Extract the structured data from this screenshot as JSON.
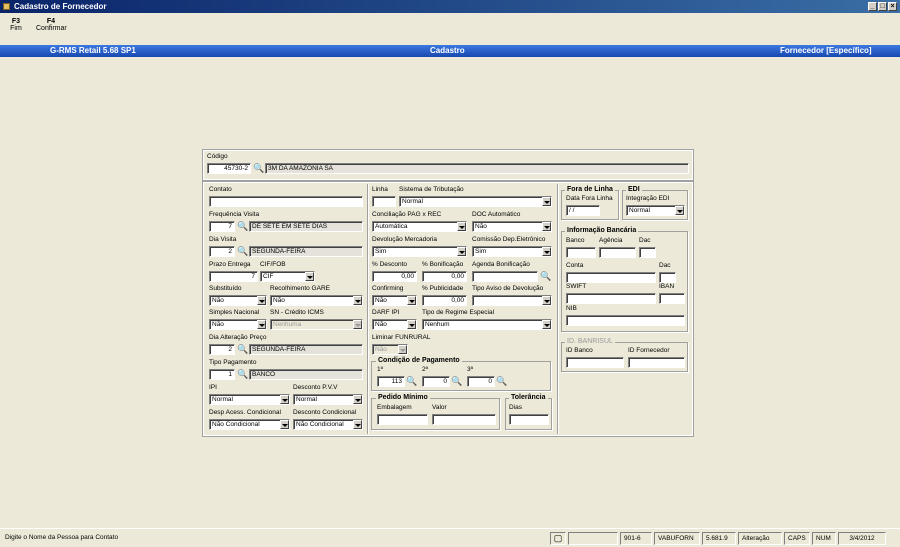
{
  "window": {
    "title": "Cadastro de Fornecedor"
  },
  "toolbar": [
    {
      "key": "F3",
      "label": "Fim"
    },
    {
      "key": "F4",
      "label": "Confirmar"
    }
  ],
  "banner": {
    "left": "G-RMS Retail 5.68 SP1",
    "center": "Cadastro",
    "right": "Fornecedor [Específico]"
  },
  "header": {
    "codigo_label": "Código",
    "codigo": "45730-2",
    "nome": "3M DA AMAZONIA SA"
  },
  "left": {
    "contato_label": "Contato",
    "contato": "",
    "freq_label": "Frequência Visita",
    "freq_num": "7",
    "freq_desc": "DE SETE EM SETE DIAS",
    "dia_label": "Dia Visita",
    "dia_num": "2",
    "dia_desc": "SEGUNDA-FEIRA",
    "prazo_label": "Prazo Entrega",
    "prazo": "7",
    "cif_label": "CIF/FOB",
    "cif": "CIF",
    "subst_label": "Substituído",
    "subst": "Não",
    "gare_label": "Recolhimento GARE",
    "gare": "Não",
    "simples_label": "Simples Nacional",
    "simples": "Não",
    "sncred_label": "SN - Crédito ICMS",
    "sncred": "Nenhuma",
    "diaalt_label": "Dia Alteração Preço",
    "diaalt_num": "2",
    "diaalt_desc": "SEGUNDA-FEIRA",
    "tipopag_label": "Tipo Pagamento",
    "tipopag_num": "1",
    "tipopag_desc": "BANCO",
    "ipi_label": "IPI",
    "ipi": "Normal",
    "pvv_label": "Desconto P.V.V",
    "pvv": "Normal",
    "despcond_label": "Desp Acess. Condicional",
    "despcond": "Não Condicional",
    "desccond_label": "Desconto Condicional",
    "desccond": "Não Condicional"
  },
  "mid": {
    "linha_label": "Linha",
    "linha": "",
    "trib_label": "Sistema de Tributação",
    "trib": "Normal",
    "concil_label": "Conciliação PAG x REC",
    "concil": "Automática",
    "doc_label": "DOC Automático",
    "doc": "Não",
    "devol_label": "Devolução Mercadoria",
    "devol": "Sim",
    "comiss_label": "Comissão Dep.Eletrônico",
    "comiss": "Sim",
    "desconto_label": "% Desconto",
    "desconto": "0,00",
    "bonif_label": "% Bonificação",
    "bonif": "0,00",
    "agenda_label": "Agenda Bonificação",
    "agenda": "",
    "confirming_label": "Confirming",
    "confirming": "Não",
    "public_label": "% Publicidade",
    "public": "0,00",
    "aviso_label": "Tipo Aviso de Devolução",
    "aviso": "",
    "darf_label": "DARF IPI",
    "darf": "Não",
    "regime_label": "Tipo de Regime Especial",
    "regime": "Nenhum",
    "liminar_label": "Liminar FUNRURAL",
    "liminar": "Não",
    "condpag_title": "Condição de Pagamento",
    "cond1_label": "1ª",
    "cond1": "113",
    "cond2_label": "2ª",
    "cond2": "0",
    "cond3_label": "3ª",
    "cond3": "0",
    "pedido_title": "Pedido Mínimo",
    "embal_label": "Embalagem",
    "embal": "",
    "valor_label": "Valor",
    "valor": "",
    "toler_title": "Tolerância",
    "dias_label": "Dias",
    "dias": ""
  },
  "right": {
    "fora_title": "Fora de Linha",
    "datafora_label": "Data Fora Linha",
    "datafora": " / /",
    "edi_title": "EDI",
    "integ_label": "Integração EDI",
    "integ": "Normal",
    "banc_title": "Informação Bancária",
    "banco_label": "Banco",
    "agencia_label": "Agência",
    "dac_label": "Dac",
    "conta_label": "Conta",
    "dac2_label": "Dac",
    "swift_label": "SWIFT",
    "iban_label": "IBAN",
    "nib_label": "NIB",
    "banrisul_title": "ID. BANRISUL",
    "idbanco_label": "ID Banco",
    "idforn_label": "ID Fornecedor"
  },
  "statusbar": {
    "message": "Digite o Nome da Pessoa para Contato",
    "code": "901-6",
    "user": "VABUFORN",
    "version": "5.681.9",
    "mode": "Alteração",
    "caps": "CAPS",
    "num": "NUM",
    "date": "3/4/2012"
  }
}
